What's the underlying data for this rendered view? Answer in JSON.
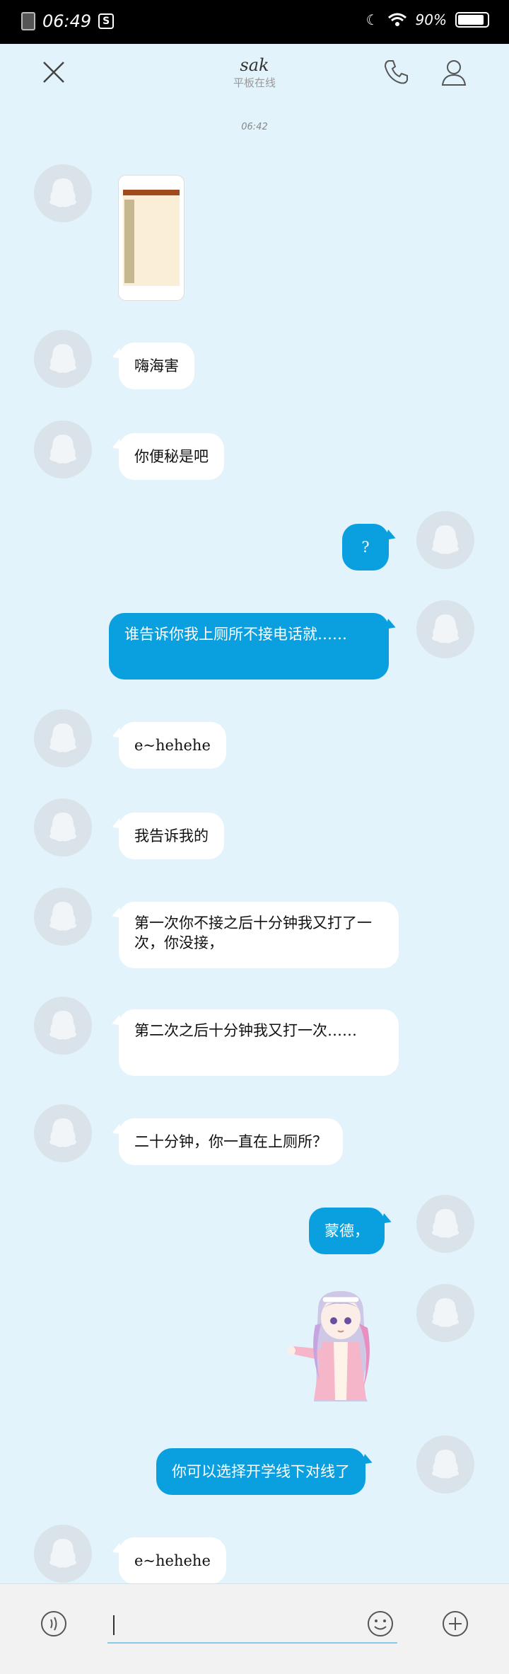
{
  "status_bar": {
    "time": "06:49",
    "battery": "90%"
  },
  "header": {
    "title": "sak",
    "subtitle": "平板在线"
  },
  "time_label": "06:42",
  "messages": [
    {
      "side": "in",
      "kind": "image"
    },
    {
      "side": "in",
      "text": "嗨海害"
    },
    {
      "side": "in",
      "text": "你便秘是吧"
    },
    {
      "side": "out",
      "text": "?"
    },
    {
      "side": "out",
      "text": "谁告诉你我上厕所不接电话就……"
    },
    {
      "side": "in",
      "text": "e~hehehe"
    },
    {
      "side": "in",
      "text": "我告诉我的"
    },
    {
      "side": "in",
      "text": "第一次你不接之后十分钟我又打了一次，你没接，"
    },
    {
      "side": "in",
      "text": "第二次之后十分钟我又打一次……"
    },
    {
      "side": "in",
      "text": "二十分钟，你一直在上厕所？"
    },
    {
      "side": "out",
      "text": "蒙德，"
    },
    {
      "side": "out",
      "kind": "sticker"
    },
    {
      "side": "out",
      "text": "你可以选择开学线下对线了"
    },
    {
      "side": "in",
      "text": "e~hehehe"
    }
  ],
  "icons": {
    "close": "close-icon",
    "call": "phone-icon",
    "profile": "profile-icon",
    "voice": "voice-icon",
    "emoji": "emoji-icon",
    "plus": "plus-icon"
  },
  "colors": {
    "background": "#e3f3fb",
    "outgoing": "#0aa0e0",
    "incoming": "#ffffff"
  }
}
